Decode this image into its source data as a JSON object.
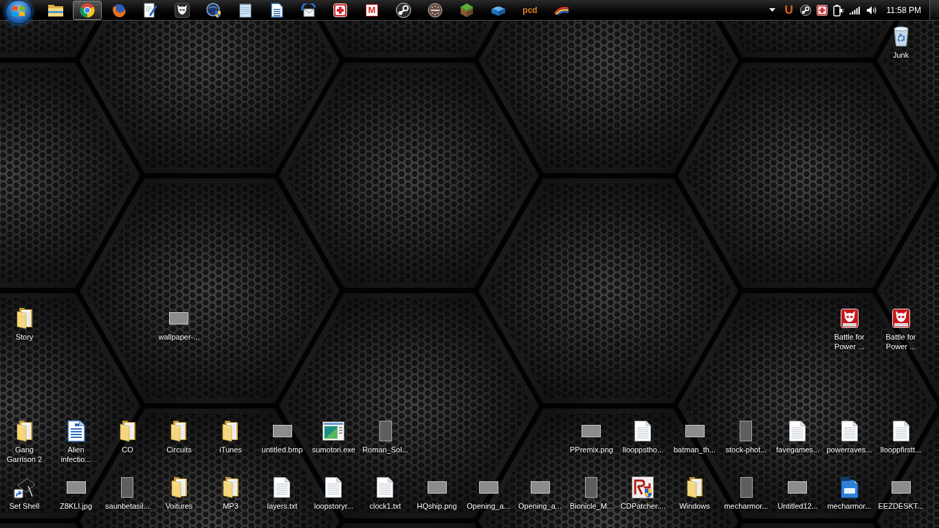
{
  "taskbar": {
    "apps": [
      {
        "kind": "folder",
        "selected": false
      },
      {
        "kind": "ring",
        "selected": true
      },
      {
        "kind": "globe",
        "selected": false
      },
      {
        "kind": "editdoc",
        "selected": false
      },
      {
        "kind": "alien",
        "selected": false
      },
      {
        "kind": "shieldglobe",
        "selected": false
      },
      {
        "kind": "notepad",
        "selected": false
      },
      {
        "kind": "writer",
        "selected": false
      },
      {
        "kind": "mail",
        "selected": false
      },
      {
        "kind": "cross",
        "selected": false
      },
      {
        "kind": "lettertile",
        "text": "M",
        "selected": false
      },
      {
        "kind": "piston",
        "selected": false
      },
      {
        "kind": "disc",
        "selected": false
      },
      {
        "kind": "block",
        "selected": false
      },
      {
        "kind": "brick",
        "selected": false
      },
      {
        "kind": "wordmark",
        "text": "pcd",
        "selected": false
      },
      {
        "kind": "swoosh",
        "selected": false
      }
    ],
    "tray": {
      "icons": [
        {
          "kind": "wordmark",
          "text": "U"
        },
        {
          "kind": "piston"
        },
        {
          "kind": "cross"
        },
        {
          "kind": "plug"
        },
        {
          "kind": "signal"
        },
        {
          "kind": "volume"
        }
      ],
      "clock": "11:58 PM"
    }
  },
  "desktop": {
    "recycle_bin": {
      "kind": "bin",
      "label": "Junk"
    },
    "middle_row": {
      "left": [
        {
          "kind": "folder",
          "label": "Story"
        }
      ],
      "center": [
        {
          "kind": "photo_wide",
          "label": "wallpaper-..."
        }
      ],
      "right": [
        {
          "kind": "audio",
          "label": "Battle for Power ..."
        },
        {
          "kind": "audio",
          "label": "Battle for Power ..."
        }
      ]
    },
    "lower_row": {
      "left": [
        {
          "kind": "folder",
          "label": "Gang Garrison 2"
        },
        {
          "kind": "writer",
          "label": "Alien infectio..."
        },
        {
          "kind": "folder",
          "label": "CO"
        },
        {
          "kind": "folder",
          "label": "Circuits"
        },
        {
          "kind": "folder",
          "label": "iTunes"
        },
        {
          "kind": "photo_wide",
          "label": "untitled.bmp"
        },
        {
          "kind": "program",
          "label": "sumotori.exe"
        },
        {
          "kind": "photo_tall",
          "label": "Roman_Sol..."
        }
      ],
      "right": [
        {
          "kind": "photo_wide",
          "label": "PPremix.png"
        },
        {
          "kind": "text",
          "label": "llooppstho..."
        },
        {
          "kind": "photo_wide",
          "label": "batman_th..."
        },
        {
          "kind": "photo_tall",
          "label": "stock-phot..."
        },
        {
          "kind": "text",
          "label": "favegames..."
        },
        {
          "kind": "text",
          "label": "powerraves..."
        },
        {
          "kind": "text",
          "label": "llooppfirstt..."
        }
      ]
    },
    "bottom_row": [
      {
        "kind": "shortcut",
        "label": "Set Shell"
      },
      {
        "kind": "photo_wide",
        "label": "Z8KLI.jpg"
      },
      {
        "kind": "photo_tall",
        "label": "saunbetasil..."
      },
      {
        "kind": "folder",
        "label": "Voitures"
      },
      {
        "kind": "folder",
        "label": "MP3"
      },
      {
        "kind": "text",
        "label": "layers.txt"
      },
      {
        "kind": "text",
        "label": "loopstoryr..."
      },
      {
        "kind": "text",
        "label": "clock1.txt"
      },
      {
        "kind": "photo_wide",
        "label": "HQship.png"
      },
      {
        "kind": "photo_wide",
        "label": "Opening_a..."
      },
      {
        "kind": "photo_wide",
        "label": "Opening_a..."
      },
      {
        "kind": "photo_tall",
        "label": "Bionicle_M..."
      },
      {
        "kind": "patcher",
        "label": "CDPatcher...."
      },
      {
        "kind": "folder",
        "label": "Windows"
      },
      {
        "kind": "photo_tall",
        "label": "mecharmor..."
      },
      {
        "kind": "photo_wide",
        "label": "Untitled12..."
      },
      {
        "kind": "psd",
        "label": "mecharmor..."
      },
      {
        "kind": "photo_wide",
        "label": "EEZDESKT..."
      }
    ]
  }
}
